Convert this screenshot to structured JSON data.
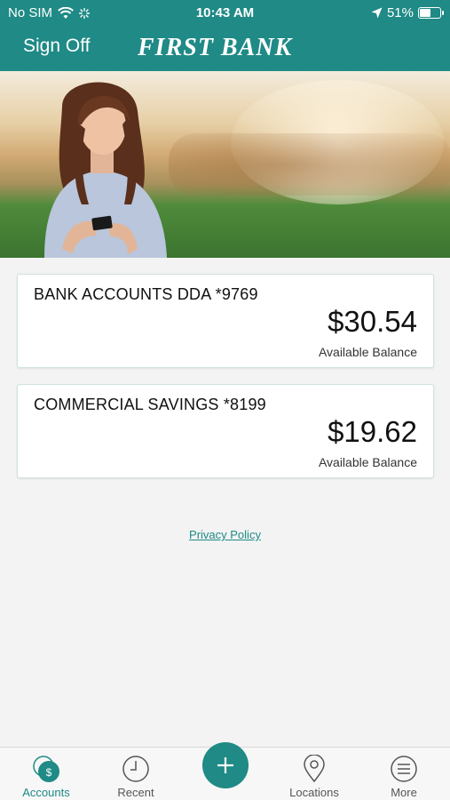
{
  "status_bar": {
    "carrier": "No SIM",
    "time": "10:43 AM",
    "battery": "51%"
  },
  "header": {
    "sign_off": "Sign Off",
    "brand": "FIRST BANK"
  },
  "accounts": [
    {
      "name": "BANK ACCOUNTS DDA *9769",
      "balance": "$30.54",
      "label": "Available Balance"
    },
    {
      "name": "COMMERCIAL SAVINGS *8199",
      "balance": "$19.62",
      "label": "Available Balance"
    }
  ],
  "footer": {
    "privacy_policy": "Privacy Policy"
  },
  "tabbar": {
    "accounts": "Accounts",
    "recent": "Recent",
    "locations": "Locations",
    "more": "More"
  },
  "colors": {
    "brand_teal": "#1f8a86",
    "background": "#f3f3f3"
  }
}
